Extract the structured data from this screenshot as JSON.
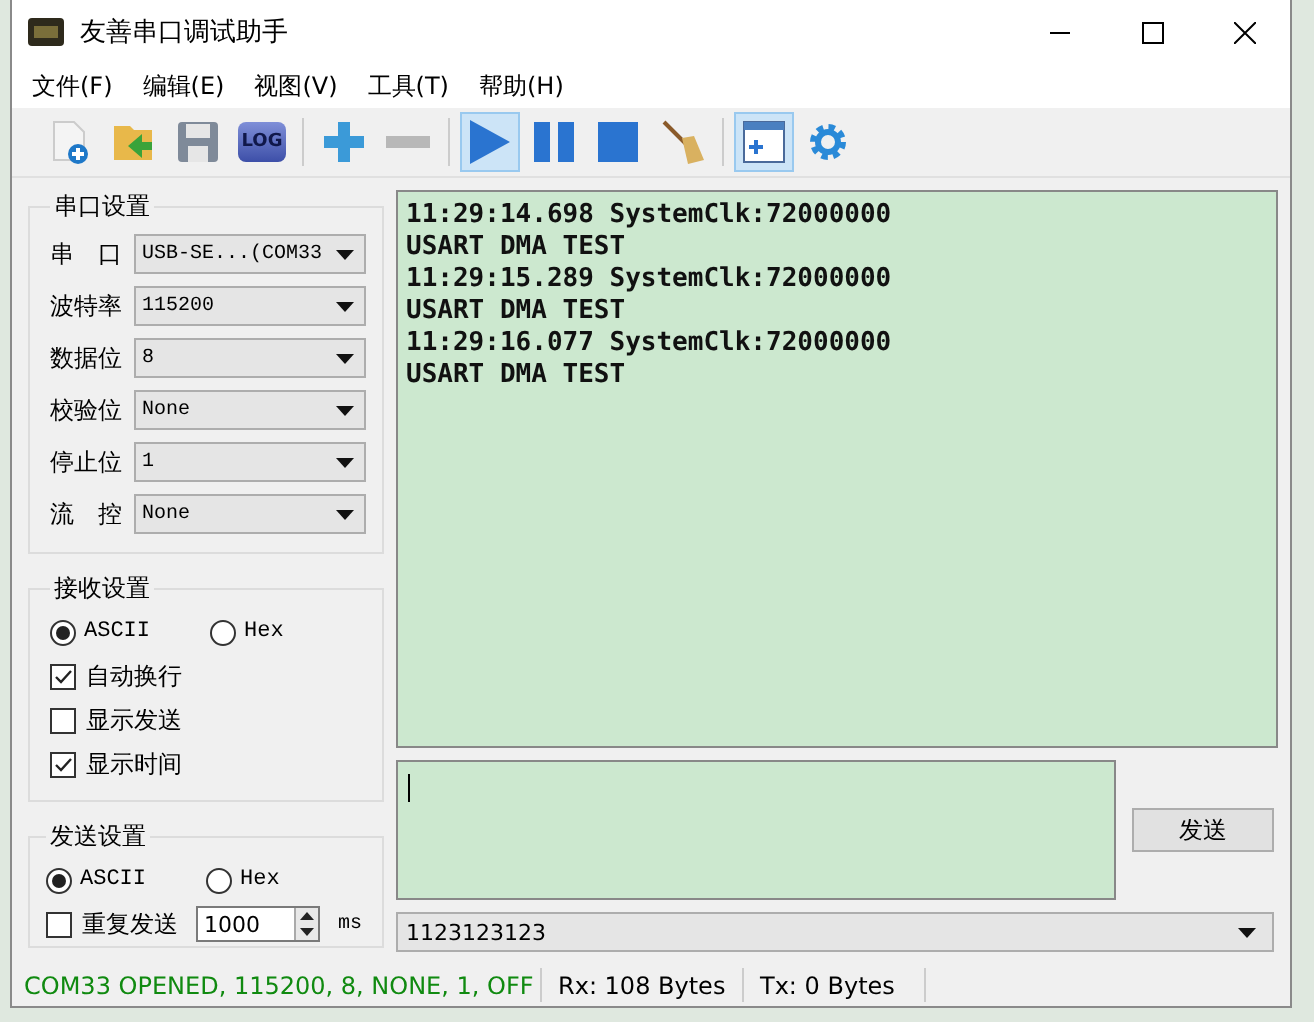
{
  "window": {
    "title": "友善串口调试助手"
  },
  "menu": [
    "文件(F)",
    "编辑(E)",
    "视图(V)",
    "工具(T)",
    "帮助(H)"
  ],
  "toolbar": [
    {
      "kind": "new-file",
      "selected": false
    },
    {
      "kind": "open-folder",
      "selected": false
    },
    {
      "kind": "save",
      "selected": false
    },
    {
      "kind": "log",
      "label": "LOG",
      "selected": false
    },
    {
      "kind": "separator"
    },
    {
      "kind": "add",
      "selected": false
    },
    {
      "kind": "remove",
      "selected": false
    },
    {
      "kind": "separator"
    },
    {
      "kind": "play",
      "selected": true
    },
    {
      "kind": "pause",
      "selected": false
    },
    {
      "kind": "stop",
      "selected": false
    },
    {
      "kind": "clear",
      "selected": false
    },
    {
      "kind": "separator"
    },
    {
      "kind": "panel",
      "selected": true
    },
    {
      "kind": "settings",
      "selected": false
    }
  ],
  "serial_settings": {
    "title": "串口设置",
    "fields": [
      {
        "label": "串口",
        "value": "USB-SE...(COM33"
      },
      {
        "label": "波特率",
        "value": "115200"
      },
      {
        "label": "数据位",
        "value": "8"
      },
      {
        "label": "校验位",
        "value": "None"
      },
      {
        "label": "停止位",
        "value": "1"
      },
      {
        "label": "流控",
        "value": "None"
      }
    ]
  },
  "receive_settings": {
    "title": "接收设置",
    "modes": [
      {
        "label": "ASCII",
        "selected": true
      },
      {
        "label": "Hex",
        "selected": false
      }
    ],
    "options": [
      {
        "label": "自动换行",
        "checked": true
      },
      {
        "label": "显示发送",
        "checked": false
      },
      {
        "label": "显示时间",
        "checked": true
      }
    ]
  },
  "send_settings": {
    "title": "发送设置",
    "modes": [
      {
        "label": "ASCII",
        "selected": true
      },
      {
        "label": "Hex",
        "selected": false
      }
    ],
    "repeat": {
      "label": "重复发送",
      "checked": false,
      "value": "1000",
      "unit": "ms"
    }
  },
  "receive_log": [
    "11:29:14.698 SystemClk:72000000",
    "USART DMA TEST",
    "11:29:15.289 SystemClk:72000000",
    "USART DMA TEST",
    "11:29:16.077 SystemClk:72000000",
    "USART DMA TEST"
  ],
  "send_button": "发送",
  "history": {
    "value": "1123123123"
  },
  "status_bar": {
    "connection": "COM33 OPENED, 115200, 8, NONE, 1, OFF",
    "rx": "Rx: 108 Bytes",
    "tx": "Tx: 0 Bytes"
  }
}
